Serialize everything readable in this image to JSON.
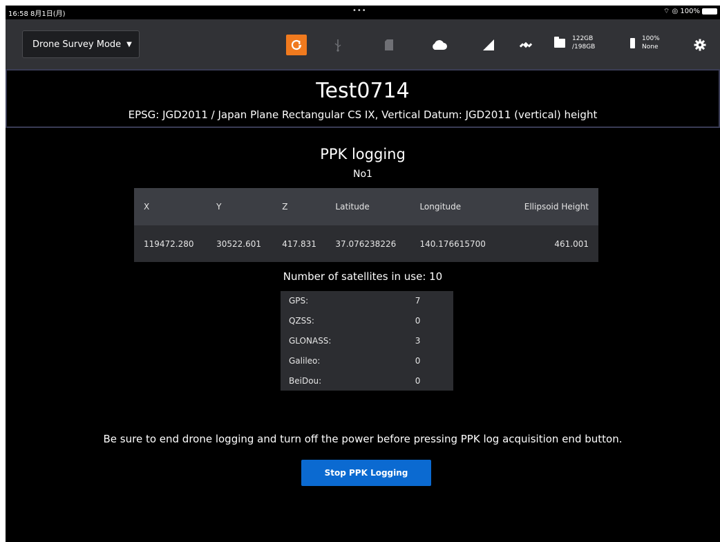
{
  "statusbar": {
    "time": "16:58  8月1日(月)",
    "dots": "•••",
    "right": "⌔ ◎ 100%"
  },
  "toolbar": {
    "mode_label": "Drone Survey Mode",
    "icons": [
      "alert-icon",
      "usb-icon",
      "sd-card-icon",
      "cloud-icon",
      "signal-icon",
      "satellite-icon",
      "folder-icon",
      "battery-icon",
      "gear-icon"
    ],
    "storage_used": "122GB",
    "storage_total": "/198GB",
    "battery_percent": "100%",
    "battery_status": "None",
    "accent_color": "#f07a1e"
  },
  "project": {
    "title": "Test0714",
    "epsg": "EPSG: JGD2011 / Japan Plane Rectangular CS IX, Vertical Datum: JGD2011 (vertical) height"
  },
  "ppk": {
    "title": "PPK logging",
    "number": "No1",
    "columns": [
      "X",
      "Y",
      "Z",
      "Latitude",
      "Longitude",
      "Ellipsoid Height"
    ],
    "row": [
      "119472.280",
      "30522.601",
      "417.831",
      "37.076238226",
      "140.176615700",
      "461.001"
    ],
    "satellites_label": "Number of satellites in use: 10",
    "satellites": [
      {
        "name": "GPS:",
        "count": "7"
      },
      {
        "name": "QZSS:",
        "count": "0"
      },
      {
        "name": "GLONASS:",
        "count": "3"
      },
      {
        "name": "Galileo:",
        "count": "0"
      },
      {
        "name": "BeiDou:",
        "count": "0"
      }
    ],
    "warning": "Be sure to end drone logging and turn off the power before pressing PPK log acquisition end button.",
    "stop_button": "Stop PPK Logging",
    "button_color": "#0b6ad1"
  }
}
